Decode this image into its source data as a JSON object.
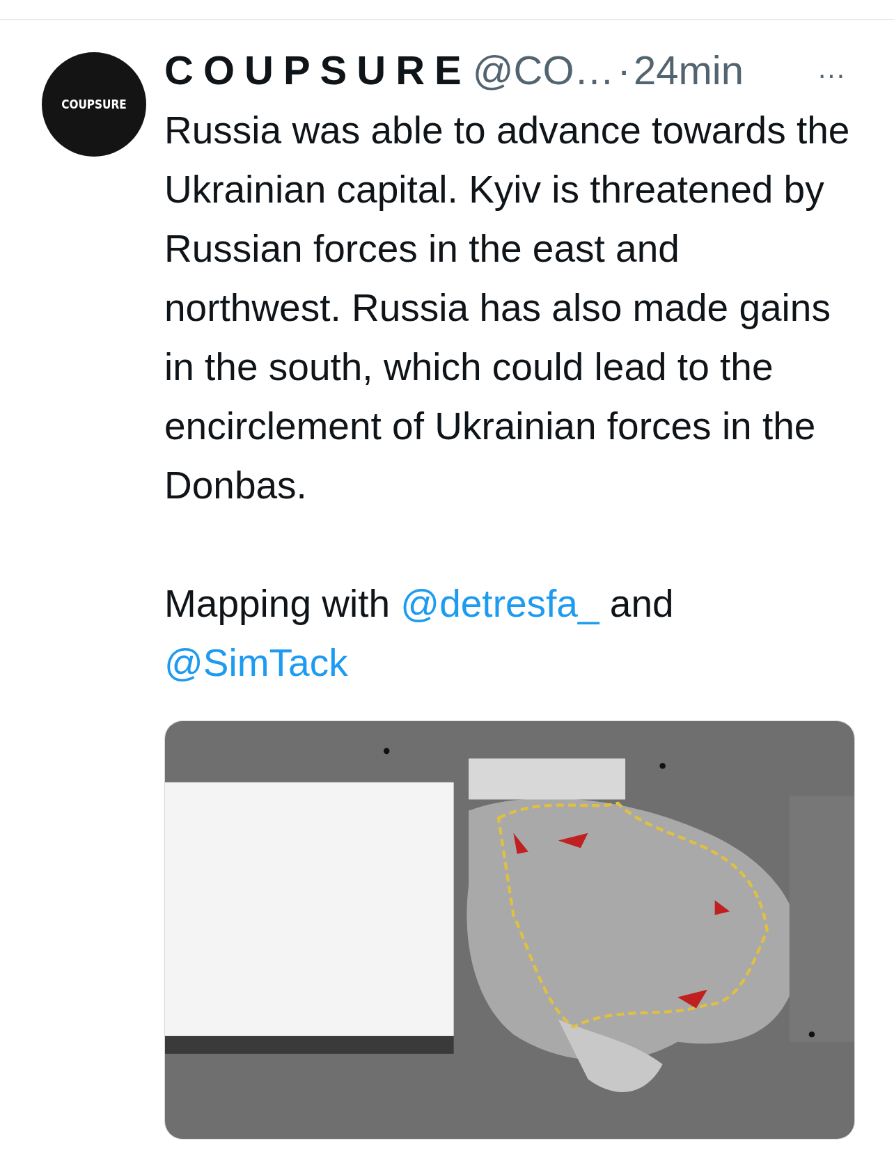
{
  "tweet": {
    "avatar": {
      "logo_text": "COUPSURE"
    },
    "author": {
      "name": "COUPSURE",
      "handle": "@CO…",
      "separator": "·",
      "time": "24min"
    },
    "more": "···",
    "paragraphs": [
      {
        "kind": "text",
        "text": "Russia was able to advance towards the Ukrainian capital. Kyiv is threatened by Russian forces in the east and northwest. Russia has also made gains in the south, which could lead to the encirclement of Ukrainian forces in the Donbas."
      },
      {
        "kind": "mixed",
        "parts": [
          {
            "kind": "text",
            "text": "Mapping with "
          },
          {
            "kind": "mention",
            "text": "@detresfa_"
          },
          {
            "kind": "text",
            "text": " and "
          },
          {
            "kind": "mention",
            "text": "@SimTack"
          }
        ]
      }
    ]
  }
}
